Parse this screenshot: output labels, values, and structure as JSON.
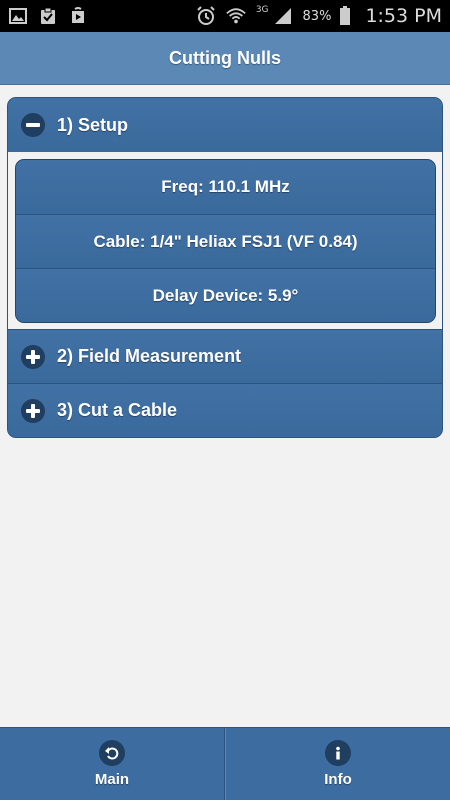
{
  "status_bar": {
    "notification_icons": [
      "gallery-icon",
      "clipboard-check-icon",
      "play-store-icon"
    ],
    "network_type": "3G",
    "battery_percent": "83%",
    "time": "1:53 PM"
  },
  "header": {
    "title": "Cutting Nulls"
  },
  "accordion": {
    "sections": [
      {
        "label": "1) Setup",
        "expanded": true
      },
      {
        "label": "2) Field Measurement",
        "expanded": false
      },
      {
        "label": "3) Cut a Cable",
        "expanded": false
      }
    ],
    "setup_items": [
      {
        "label": "Freq: 110.1 MHz"
      },
      {
        "label": "Cable: 1/4\" Heliax FSJ1 (VF 0.84)"
      },
      {
        "label": "Delay Device: 5.9°"
      }
    ]
  },
  "footer": {
    "buttons": [
      {
        "label": "Main",
        "icon": "back-arrow-icon"
      },
      {
        "label": "Info",
        "icon": "info-icon"
      }
    ]
  },
  "colors": {
    "header": "#5b88b5",
    "accent": "#3c6c9f",
    "icon_circle": "#1f3e60",
    "background": "#f2f2f2"
  }
}
